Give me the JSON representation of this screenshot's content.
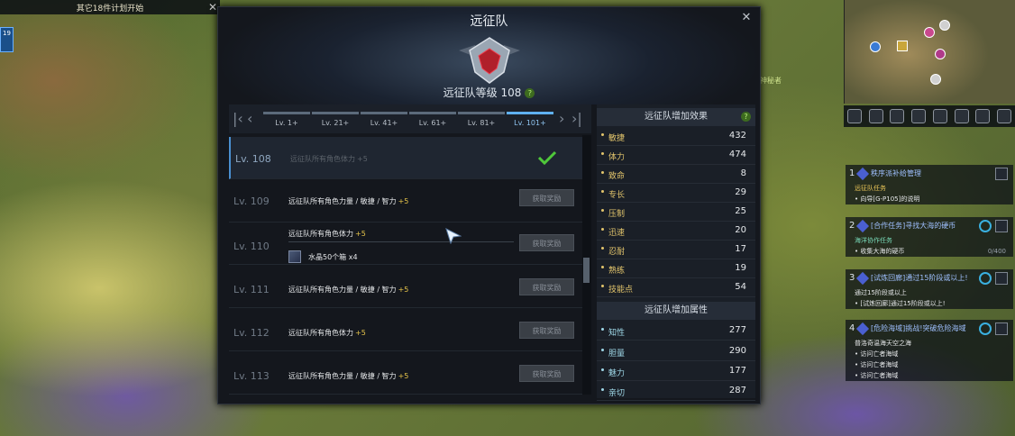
{
  "top_notice": {
    "text": "其它18件计划开始",
    "close": "✕"
  },
  "left_badge": {
    "value": "19"
  },
  "hud_label": "神秘者",
  "window": {
    "title": "远征队",
    "close": "✕",
    "level_label": "远征队等级 108",
    "help": "?",
    "tabs": [
      {
        "label": "Lv. 1+"
      },
      {
        "label": "Lv. 21+"
      },
      {
        "label": "Lv. 41+"
      },
      {
        "label": "Lv. 61+"
      },
      {
        "label": "Lv. 81+"
      },
      {
        "label": "Lv. 101+",
        "active": true
      }
    ],
    "rows": [
      {
        "level": "Lv. 108",
        "desc": "远征队所有角色体力",
        "plus": "+5",
        "claimed": true
      },
      {
        "level": "Lv. 109",
        "desc": "远征队所有角色力量 / 敏捷 / 智力",
        "plus": "+5",
        "button": "获取奖励"
      },
      {
        "level": "Lv. 110",
        "desc": "远征队所有角色体力",
        "plus": "+5",
        "button": "获取奖励",
        "item": "水晶50个箱 x4"
      },
      {
        "level": "Lv. 111",
        "desc": "远征队所有角色力量 / 敏捷 / 智力",
        "plus": "+5",
        "button": "获取奖励"
      },
      {
        "level": "Lv. 112",
        "desc": "远征队所有角色体力",
        "plus": "+5",
        "button": "获取奖励"
      },
      {
        "level": "Lv. 113",
        "desc": "远征队所有角色力量 / 敏捷 / 智力",
        "plus": "+5",
        "button": "获取奖励"
      }
    ],
    "effects_title": "远征队增加效果",
    "effects": [
      {
        "name": "敏捷",
        "value": "432"
      },
      {
        "name": "体力",
        "value": "474"
      },
      {
        "name": "致命",
        "value": "8"
      },
      {
        "name": "专长",
        "value": "29"
      },
      {
        "name": "压制",
        "value": "25"
      },
      {
        "name": "迅速",
        "value": "20"
      },
      {
        "name": "忍耐",
        "value": "17"
      },
      {
        "name": "熟练",
        "value": "19"
      },
      {
        "name": "技能点",
        "value": "54"
      }
    ],
    "attributes_title": "远征队增加属性",
    "attributes": [
      {
        "name": "知性",
        "value": "277"
      },
      {
        "name": "胆量",
        "value": "290"
      },
      {
        "name": "魅力",
        "value": "177"
      },
      {
        "name": "亲切",
        "value": "287"
      }
    ]
  },
  "quests": [
    {
      "num": "1",
      "title": "秩序派补给管理",
      "lines": [
        {
          "text": "远征队任务",
          "style": "sub"
        },
        {
          "text": "向导[G-P105]的说明"
        }
      ]
    },
    {
      "num": "2",
      "title": "[合作任务]寻找大海的硬币",
      "lines": [
        {
          "text": "海洋协作任务",
          "style": "grn"
        },
        {
          "text": "收集大海的硬币",
          "count": "0/400"
        }
      ]
    },
    {
      "num": "3",
      "title": "[试炼回廊]通过15阶段或以上!",
      "lines": [
        {
          "text": "通过15阶段或以上"
        },
        {
          "text": "[试炼回廊]通过15阶段或以上!"
        }
      ]
    },
    {
      "num": "4",
      "title": "[危险海域]挑战!突破危险海域",
      "lines": [
        {
          "text": "普洛奇温海天空之海",
          "style": "sub"
        },
        {
          "text": "访问亡者海域"
        },
        {
          "text": "访问亡者海域"
        },
        {
          "text": "访问亡者海域"
        }
      ]
    }
  ]
}
